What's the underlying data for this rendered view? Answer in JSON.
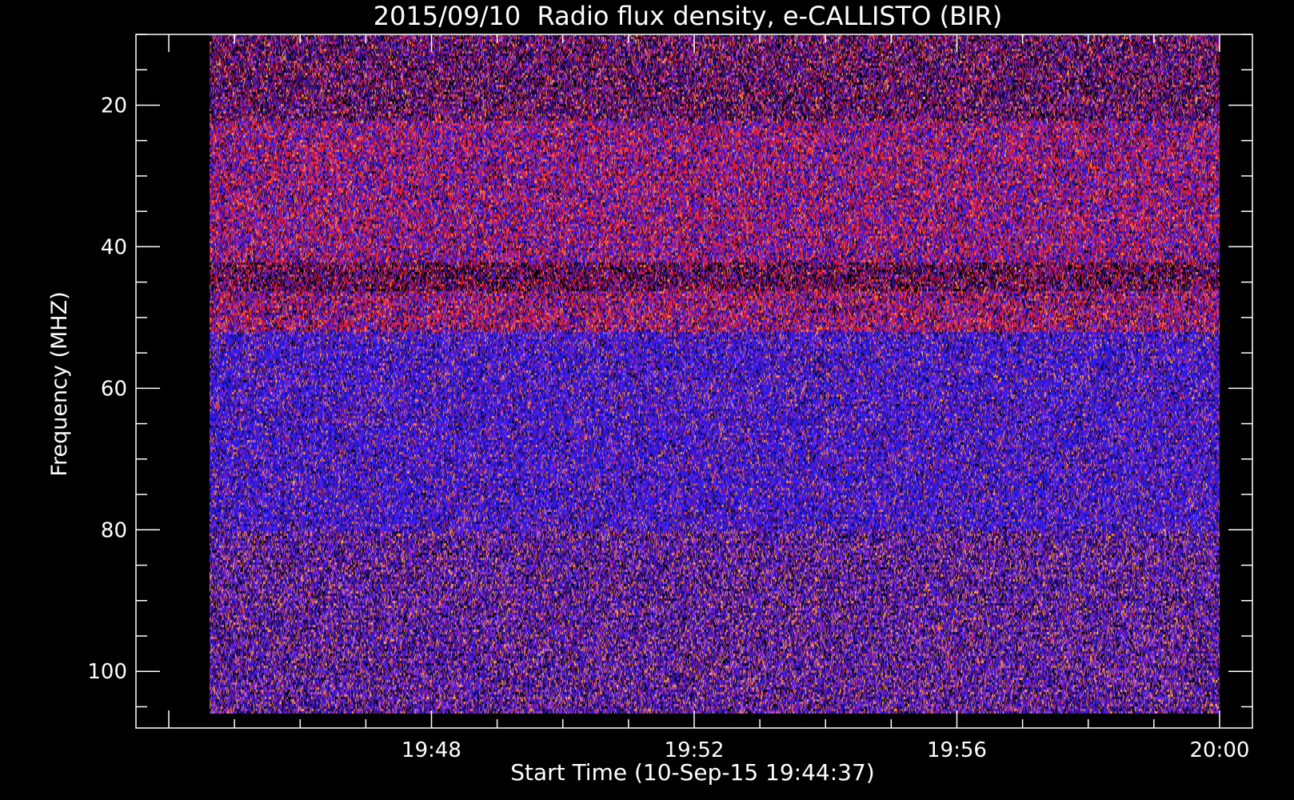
{
  "chart_data": {
    "type": "heatmap",
    "title": "2015/09/10  Radio flux density, e-CALLISTO (BIR)",
    "xlabel": "Start Time (10-Sep-15 19:44:37)",
    "ylabel": "Frequency (MHZ)",
    "x_start_time": "19:44:37",
    "x_end_time": "20:00:00",
    "xlim": [
      "19:43:30",
      "20:00:30"
    ],
    "ylim": [
      10,
      108
    ],
    "y_inverted": true,
    "x_ticks": [
      "19:48",
      "19:52",
      "19:56",
      "20:00"
    ],
    "y_ticks": [
      20,
      40,
      60,
      80,
      100
    ],
    "frequency_range": [
      10,
      106
    ],
    "colormap": [
      "#000000",
      "#2a0a5e",
      "#4a1bbf",
      "#1a1aff",
      "#8a2be2",
      "#cc1133",
      "#ff2a2a",
      "#ff8c42",
      "#ffc070"
    ],
    "bands": [
      {
        "freq_range": [
          10,
          22
        ],
        "dominant": "dark red-purple"
      },
      {
        "freq_range": [
          22,
          42
        ],
        "dominant": "red"
      },
      {
        "freq_range": [
          42,
          46
        ],
        "dominant": "dark band"
      },
      {
        "freq_range": [
          46,
          52
        ],
        "dominant": "red"
      },
      {
        "freq_range": [
          52,
          80
        ],
        "dominant": "blue"
      },
      {
        "freq_range": [
          80,
          106
        ],
        "dominant": "purple with orange speckle"
      }
    ],
    "grid": false,
    "axis_color": "#ffffff",
    "background_color": "#000000"
  }
}
